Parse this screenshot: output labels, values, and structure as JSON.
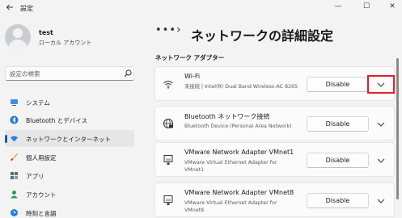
{
  "window": {
    "title": "設定",
    "back_icon": "back-arrow-icon",
    "minimize_glyph": "—",
    "maximize_glyph": "☐",
    "close_glyph": "✕"
  },
  "profile": {
    "name": "test",
    "account_type": "ローカル アカウント"
  },
  "search": {
    "placeholder": "設定の検索"
  },
  "sidebar": {
    "items": [
      {
        "label": "システム",
        "icon": "system-icon",
        "active": false
      },
      {
        "label": "Bluetooth とデバイス",
        "icon": "bluetooth-icon",
        "active": false
      },
      {
        "label": "ネットワークとインターネット",
        "icon": "network-icon",
        "active": true
      },
      {
        "label": "個人用設定",
        "icon": "brush-icon",
        "active": false
      },
      {
        "label": "アプリ",
        "icon": "apps-icon",
        "active": false
      },
      {
        "label": "アカウント",
        "icon": "account-icon",
        "active": false
      },
      {
        "label": "時刻と言語",
        "icon": "clock-icon",
        "active": false
      }
    ]
  },
  "header": {
    "ellipsis": "•••",
    "separator": "›",
    "title": "ネットワークの詳細設定"
  },
  "section": {
    "title": "ネットワーク アダプター"
  },
  "adapters": [
    {
      "name": "Wi-Fi",
      "description": "未接続 | Intel(R) Dual Band Wireless-AC 8265",
      "button": "Disable",
      "icon": "wifi-icon",
      "highlighted": true
    },
    {
      "name": "Bluetooth ネットワーク接続",
      "description": "Bluetooth Device (Personal Area Network)",
      "button": "Disable",
      "icon": "globe-icon",
      "highlighted": false
    },
    {
      "name": "VMware Network Adapter VMnet1",
      "description": "VMware Virtual Ethernet Adapter for VMnet1",
      "button": "Disable",
      "icon": "ethernet-icon",
      "highlighted": false
    },
    {
      "name": "VMware Network Adapter VMnet8",
      "description": "VMware Virtual Ethernet Adapter for VMnet8",
      "button": "Disable",
      "icon": "ethernet-icon",
      "highlighted": false
    }
  ],
  "colors": {
    "accent": "#005fb8",
    "highlight_box": "#e0202a",
    "background": "#f3f3f3",
    "card": "#fbfbfb"
  }
}
